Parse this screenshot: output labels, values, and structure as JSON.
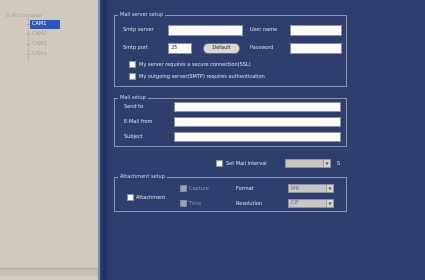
{
  "tree": {
    "root_label": "All Cameras",
    "items": [
      {
        "label": "CAM1",
        "selected": true
      },
      {
        "label": "CAM2",
        "selected": false
      },
      {
        "label": "CAM3",
        "selected": false
      },
      {
        "label": "CAM4",
        "selected": false
      }
    ]
  },
  "mail_server": {
    "group_title": "Mail server setup",
    "smtp_server_label": "Smtp server",
    "smtp_server_value": "",
    "user_name_label": "User name",
    "user_name_value": "",
    "smtp_port_label": "Smtp port",
    "smtp_port_value": "25",
    "default_button": "Default",
    "password_label": "Password",
    "password_value": "",
    "ssl_label": "My server requires a secure connection(SSL)",
    "auth_label": "My outgoing server(SMTP) requires authentication"
  },
  "mail_setup": {
    "group_title": "Mail setup",
    "send_to_label": "Send to",
    "send_to_value": "",
    "from_label": "E-Mail from",
    "from_value": "",
    "subject_label": "Subject",
    "subject_value": ""
  },
  "interval": {
    "label": "Set Mail Interval",
    "value": "",
    "unit": "S"
  },
  "attachment": {
    "group_title": "Attachment setup",
    "attachment_label": "Attachment",
    "capture_label": "Capture",
    "time_label": "Time",
    "format_label": "Format",
    "format_value": "jpg",
    "resolution_label": "Resolution",
    "resolution_value": "CIF"
  },
  "colors": {
    "panel_bg": "#2e3f6d",
    "sidebar_bg": "#cfcabd",
    "selected_bg": "#2f56b7"
  }
}
